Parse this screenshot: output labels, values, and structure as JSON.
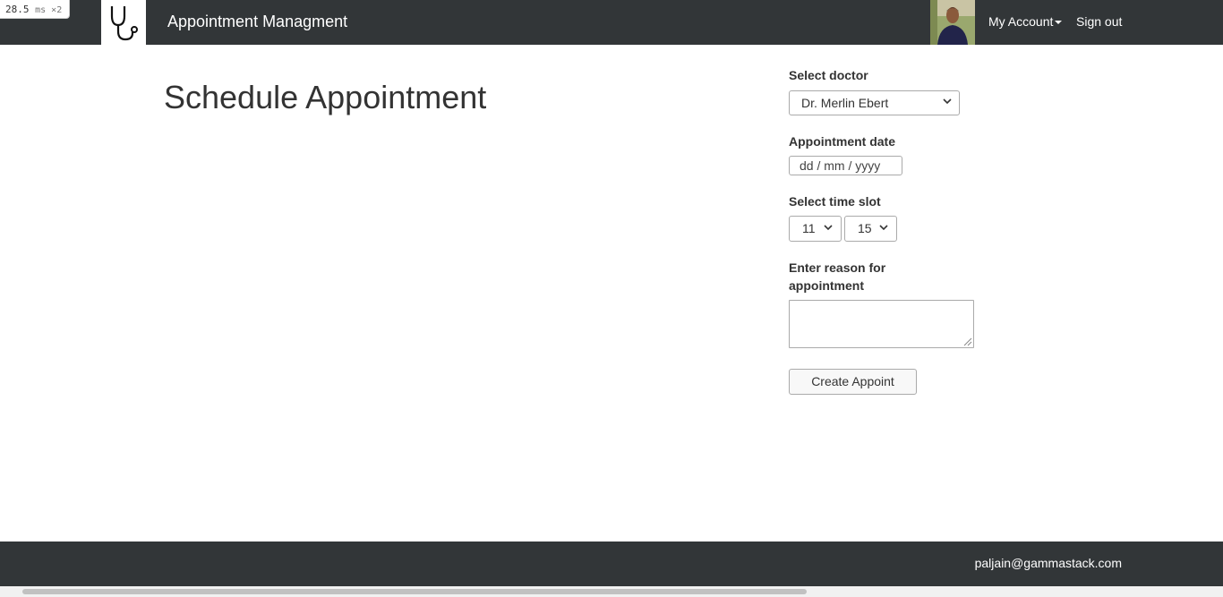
{
  "perf": {
    "value": "28.5",
    "unit": "ms ×2"
  },
  "navbar": {
    "logo_icon": "stethoscope-icon",
    "brand": "Appointment Managment",
    "account_label": "My Account",
    "signout_label": "Sign out",
    "background": "#323638"
  },
  "page": {
    "title": "Schedule Appointment"
  },
  "form": {
    "doctor": {
      "label": "Select doctor",
      "selected": "Dr. Merlin Ebert"
    },
    "date": {
      "label": "Appointment date",
      "placeholder": "dd / mm / yyyy"
    },
    "time_slot": {
      "label": "Select time slot",
      "hour": "11",
      "minute": "15"
    },
    "reason": {
      "label": "Enter reason for appointment",
      "value": ""
    },
    "submit_label": "Create Appoint"
  },
  "footer": {
    "email": "paljain@gammastack.com"
  }
}
